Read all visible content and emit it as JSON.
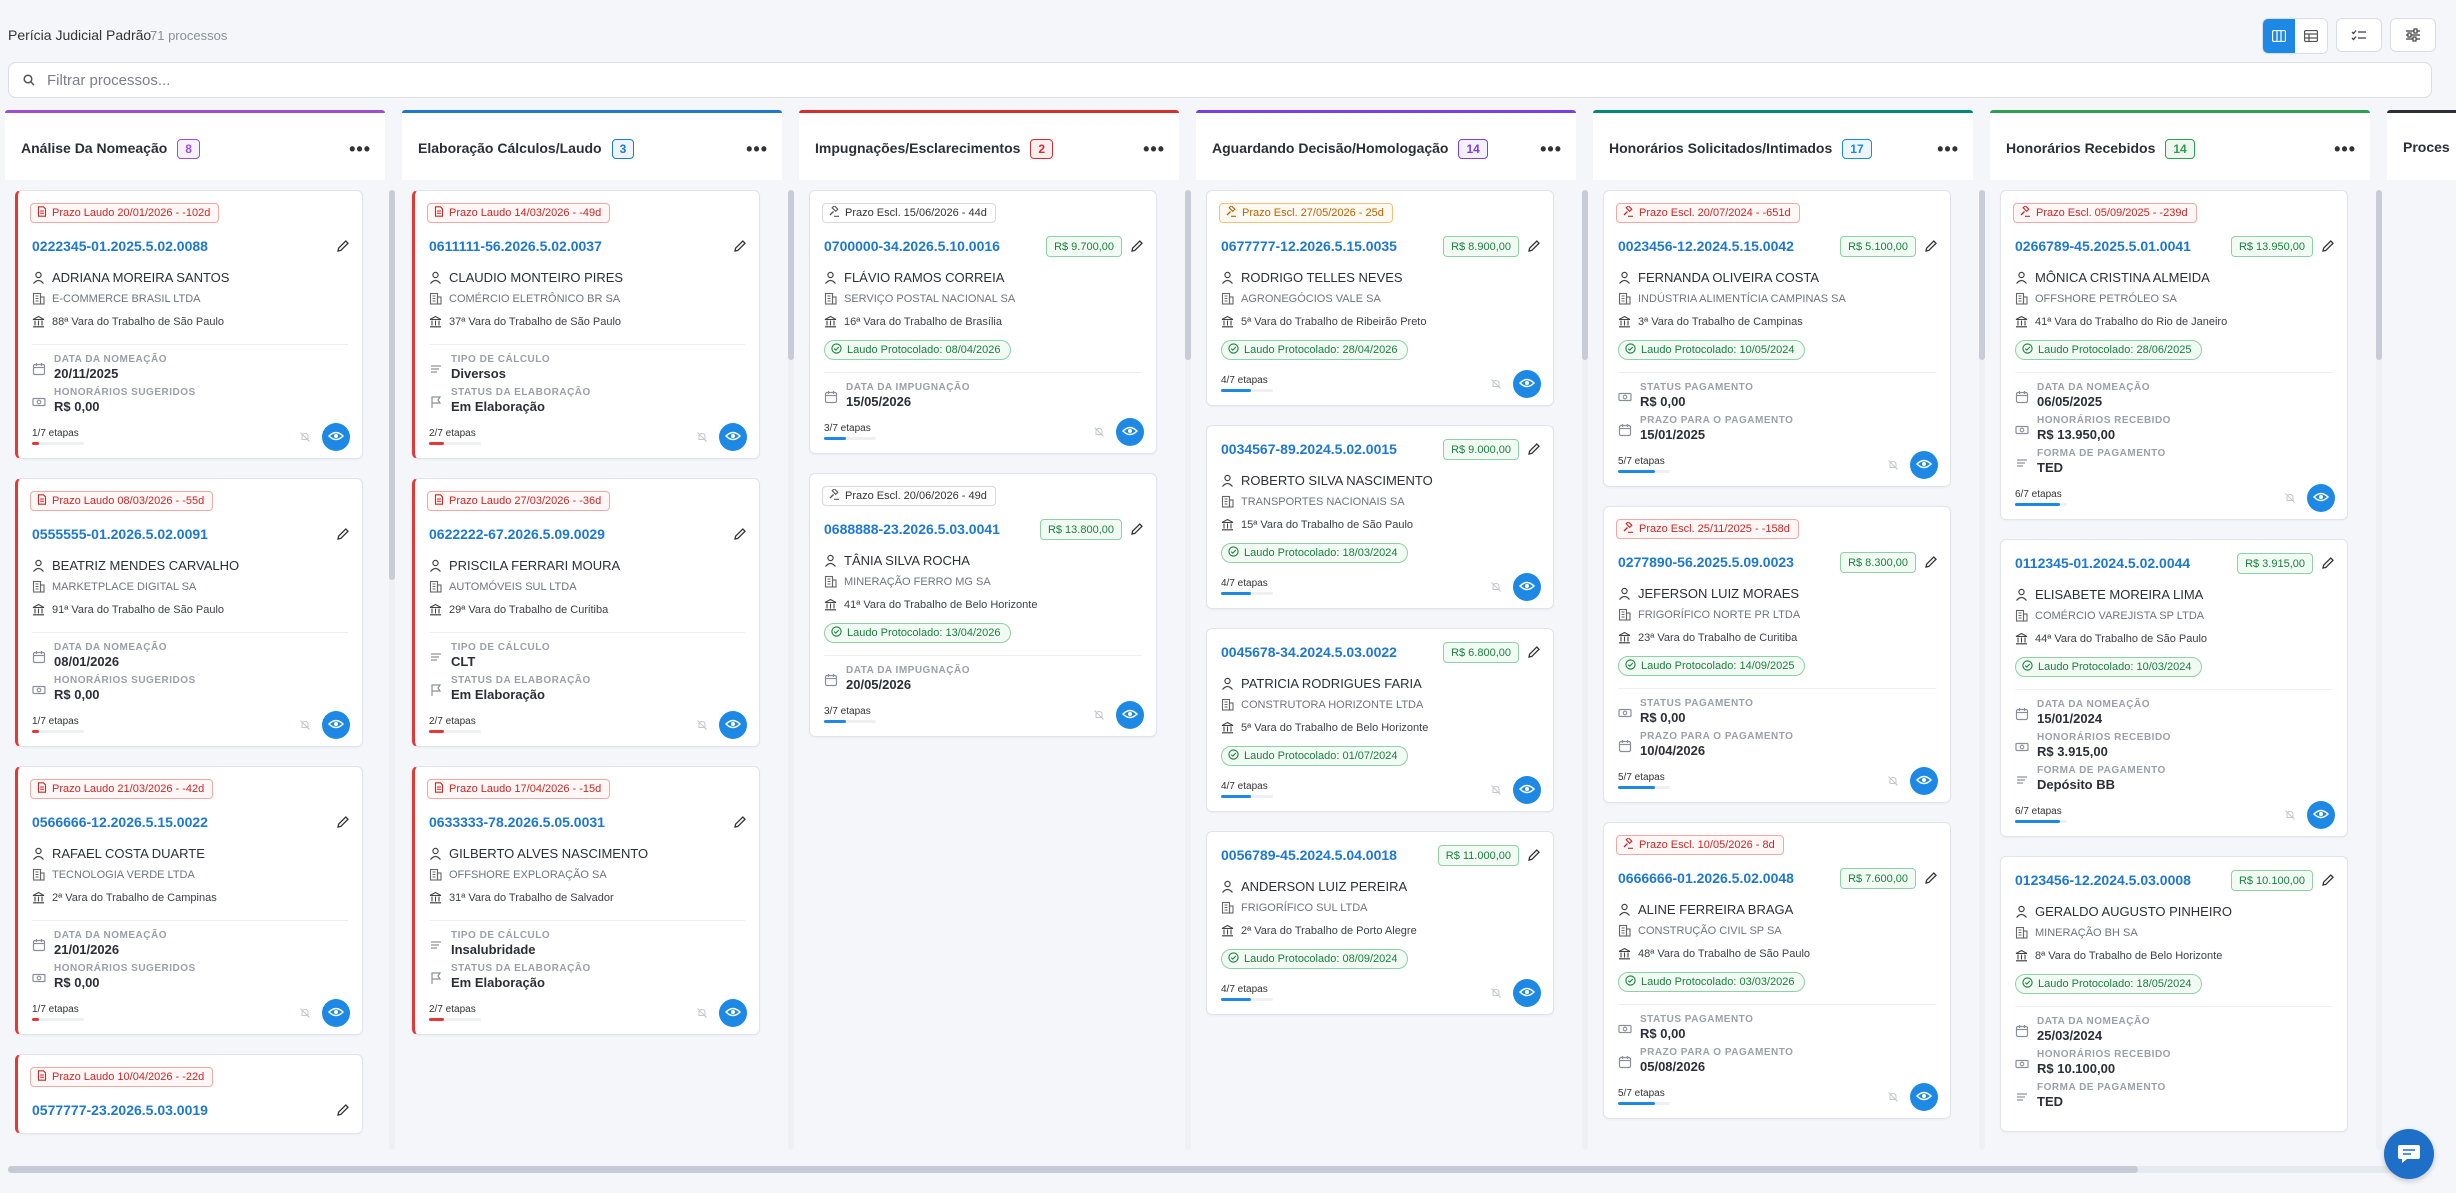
{
  "header": {
    "title": "Perícia Judicial Padrão",
    "count": "71 processos"
  },
  "search": {
    "placeholder": "Filtrar processos..."
  },
  "columns": [
    {
      "name": "Análise Da Nomeação",
      "count": "8",
      "color": "#9b4fd6",
      "badge_color": "#9b4fd6",
      "cards": [
        {
          "prazo": "Prazo Laudo  20/01/2026 - -102d",
          "prazo_style": "red",
          "number": "0222345-01.2025.5.02.0088",
          "client": "ADRIANA MOREIRA SANTOS",
          "company": "E-COMMERCE BRASIL LTDA",
          "court": "88ª Vara do Trabalho de São Paulo",
          "fields": [
            {
              "label": "DATA DA NOMEAÇÃO",
              "value": "20/11/2025",
              "icon": "calendar-icon"
            },
            {
              "label": "HONORÁRIOS SUGERIDOS",
              "value": "R$ 0,00",
              "icon": "money-icon"
            }
          ],
          "etapas": "1/7 etapas",
          "progress": 0.14,
          "bar_color": "#e53935"
        },
        {
          "prazo": "Prazo Laudo  08/03/2026 - -55d",
          "prazo_style": "red",
          "number": "0555555-01.2026.5.02.0091",
          "client": "BEATRIZ MENDES CARVALHO",
          "company": "MARKETPLACE DIGITAL SA",
          "court": "91ª Vara do Trabalho de São Paulo",
          "fields": [
            {
              "label": "DATA DA NOMEAÇÃO",
              "value": "08/01/2026",
              "icon": "calendar-icon"
            },
            {
              "label": "HONORÁRIOS SUGERIDOS",
              "value": "R$ 0,00",
              "icon": "money-icon"
            }
          ],
          "etapas": "1/7 etapas",
          "progress": 0.14,
          "bar_color": "#e53935"
        },
        {
          "prazo": "Prazo Laudo  21/03/2026 - -42d",
          "prazo_style": "red",
          "number": "0566666-12.2026.5.15.0022",
          "client": "RAFAEL COSTA DUARTE",
          "company": "TECNOLOGIA VERDE LTDA",
          "court": "2ª Vara do Trabalho de Campinas",
          "fields": [
            {
              "label": "DATA DA NOMEAÇÃO",
              "value": "21/01/2026",
              "icon": "calendar-icon"
            },
            {
              "label": "HONORÁRIOS SUGERIDOS",
              "value": "R$ 0,00",
              "icon": "money-icon"
            }
          ],
          "etapas": "1/7 etapas",
          "progress": 0.14,
          "bar_color": "#e53935"
        },
        {
          "prazo": "Prazo Laudo  10/04/2026 - -22d",
          "prazo_style": "red",
          "number": "0577777-23.2026.5.03.0019"
        }
      ]
    },
    {
      "name": "Elaboração Cálculos/Laudo",
      "count": "3",
      "color": "#1e78d2",
      "badge_color": "#1e78d2",
      "cards": [
        {
          "prazo": "Prazo Laudo  14/03/2026 - -49d",
          "prazo_style": "red",
          "number": "0611111-56.2026.5.02.0037",
          "client": "CLAUDIO MONTEIRO PIRES",
          "company": "COMÉRCIO ELETRÔNICO BR SA",
          "court": "37ª Vara do Trabalho de São Paulo",
          "fields": [
            {
              "label": "TIPO DE CÁLCULO",
              "value": "Diversos",
              "icon": "list-icon"
            },
            {
              "label": "STATUS DA ELABORAÇÃO",
              "value": "Em Elaboração",
              "icon": "flag-icon"
            }
          ],
          "etapas": "2/7 etapas",
          "progress": 0.28,
          "bar_color": "#e53935"
        },
        {
          "prazo": "Prazo Laudo  27/03/2026 - -36d",
          "prazo_style": "red",
          "number": "0622222-67.2026.5.09.0029",
          "client": "PRISCILA FERRARI MOURA",
          "company": "AUTOMÓVEIS SUL LTDA",
          "court": "29ª Vara do Trabalho de Curitiba",
          "fields": [
            {
              "label": "TIPO DE CÁLCULO",
              "value": "CLT",
              "icon": "list-icon"
            },
            {
              "label": "STATUS DA ELABORAÇÃO",
              "value": "Em Elaboração",
              "icon": "flag-icon"
            }
          ],
          "etapas": "2/7 etapas",
          "progress": 0.28,
          "bar_color": "#e53935"
        },
        {
          "prazo": "Prazo Laudo  17/04/2026 - -15d",
          "prazo_style": "red",
          "number": "0633333-78.2026.5.05.0031",
          "client": "GILBERTO ALVES NASCIMENTO",
          "company": "OFFSHORE EXPLORAÇÃO SA",
          "court": "31ª Vara do Trabalho de Salvador",
          "fields": [
            {
              "label": "TIPO DE CÁLCULO",
              "value": "Insalubridade",
              "icon": "list-icon"
            },
            {
              "label": "STATUS DA ELABORAÇÃO",
              "value": "Em Elaboração",
              "icon": "flag-icon"
            }
          ],
          "etapas": "2/7 etapas",
          "progress": 0.28,
          "bar_color": "#e53935"
        }
      ]
    },
    {
      "name": "Impugnações/Esclarecimentos",
      "count": "2",
      "color": "#d32f2f",
      "badge_color": "#d32f2f",
      "cards": [
        {
          "prazo": "Prazo Escl.  15/06/2026 - 44d",
          "prazo_style": "gray",
          "number": "0700000-34.2026.5.10.0016",
          "money": "R$ 9.700,00",
          "client": "FLÁVIO RAMOS CORREIA",
          "company": "SERVIÇO POSTAL NACIONAL SA",
          "court": "16ª Vara do Trabalho de Brasília",
          "laudo": "Laudo Protocolado: 08/04/2026",
          "fields": [
            {
              "label": "DATA DA IMPUGNAÇÃO",
              "value": "15/05/2026",
              "icon": "calendar-icon"
            }
          ],
          "etapas": "3/7 etapas",
          "progress": 0.43,
          "bar_color": "#1e88e5"
        },
        {
          "prazo": "Prazo Escl.  20/06/2026 - 49d",
          "prazo_style": "gray",
          "number": "0688888-23.2026.5.03.0041",
          "money": "R$ 13.800,00",
          "client": "TÂNIA SILVA ROCHA",
          "company": "MINERAÇÃO FERRO MG SA",
          "court": "41ª Vara do Trabalho de Belo Horizonte",
          "laudo": "Laudo Protocolado: 13/04/2026",
          "fields": [
            {
              "label": "DATA DA IMPUGNAÇÃO",
              "value": "20/05/2026",
              "icon": "calendar-icon"
            }
          ],
          "etapas": "3/7 etapas",
          "progress": 0.43,
          "bar_color": "#1e88e5"
        }
      ]
    },
    {
      "name": "Aguardando Decisão/Homologação",
      "count": "14",
      "color": "#7b3fe4",
      "badge_color": "#7b3fe4",
      "cards": [
        {
          "prazo": "Prazo Escl.  27/05/2026 - 25d",
          "prazo_style": "orange",
          "number": "0677777-12.2026.5.15.0035",
          "money": "R$ 8.900,00",
          "client": "RODRIGO TELLES NEVES",
          "company": "AGRONEGÓCIOS VALE SA",
          "court": "5ª Vara do Trabalho de Ribeirão Preto",
          "laudo": "Laudo Protocolado: 28/04/2026",
          "fields": [],
          "etapas": "4/7 etapas",
          "progress": 0.57,
          "bar_color": "#1e88e5"
        },
        {
          "number": "0034567-89.2024.5.02.0015",
          "money": "R$ 9.000,00",
          "client": "ROBERTO SILVA NASCIMENTO",
          "company": "TRANSPORTES NACIONAIS SA",
          "court": "15ª Vara do Trabalho de São Paulo",
          "laudo": "Laudo Protocolado: 18/03/2024",
          "fields": [],
          "etapas": "4/7 etapas",
          "progress": 0.57,
          "bar_color": "#1e88e5"
        },
        {
          "number": "0045678-34.2024.5.03.0022",
          "money": "R$ 6.800,00",
          "client": "PATRICIA RODRIGUES FARIA",
          "company": "CONSTRUTORA HORIZONTE LTDA",
          "court": "5ª Vara do Trabalho de Belo Horizonte",
          "laudo": "Laudo Protocolado: 01/07/2024",
          "fields": [],
          "etapas": "4/7 etapas",
          "progress": 0.57,
          "bar_color": "#1e88e5"
        },
        {
          "number": "0056789-45.2024.5.04.0018",
          "money": "R$ 11.000,00",
          "client": "ANDERSON LUIZ PEREIRA",
          "company": "FRIGORÍFICO SUL LTDA",
          "court": "2ª Vara do Trabalho de Porto Alegre",
          "laudo": "Laudo Protocolado: 08/09/2024",
          "fields": [],
          "etapas": "4/7 etapas",
          "progress": 0.57,
          "bar_color": "#1e88e5"
        }
      ]
    },
    {
      "name": "Honorários Solicitados/Intimados",
      "count": "17",
      "color": "#00897b",
      "badge_color": "#1e88e5",
      "cards": [
        {
          "prazo": "Prazo Escl.  20/07/2024 - -651d",
          "prazo_style": "red",
          "number": "0023456-12.2024.5.15.0042",
          "money": "R$ 5.100,00",
          "client": "FERNANDA OLIVEIRA COSTA",
          "company": "INDÚSTRIA ALIMENTÍCIA CAMPINAS SA",
          "court": "3ª Vara do Trabalho de Campinas",
          "laudo": "Laudo Protocolado: 10/05/2024",
          "fields": [
            {
              "label": "STATUS PAGAMENTO",
              "value": "R$ 0,00",
              "icon": "money-icon"
            },
            {
              "label": "PRAZO PARA O PAGAMENTO",
              "value": "15/01/2025",
              "icon": "calendar-icon"
            }
          ],
          "etapas": "5/7 etapas",
          "progress": 0.71,
          "bar_color": "#1e88e5"
        },
        {
          "prazo": "Prazo Escl.  25/11/2025 - -158d",
          "prazo_style": "red",
          "number": "0277890-56.2025.5.09.0023",
          "money": "R$ 8.300,00",
          "client": "JEFERSON LUIZ MORAES",
          "company": "FRIGORÍFICO NORTE PR LTDA",
          "court": "23ª Vara do Trabalho de Curitiba",
          "laudo": "Laudo Protocolado: 14/09/2025",
          "fields": [
            {
              "label": "STATUS PAGAMENTO",
              "value": "R$ 0,00",
              "icon": "money-icon"
            },
            {
              "label": "PRAZO PARA O PAGAMENTO",
              "value": "10/04/2026",
              "icon": "calendar-icon"
            }
          ],
          "etapas": "5/7 etapas",
          "progress": 0.71,
          "bar_color": "#1e88e5"
        },
        {
          "prazo": "Prazo Escl.  10/05/2026 - 8d",
          "prazo_style": "red",
          "number": "0666666-01.2026.5.02.0048",
          "money": "R$ 7.600,00",
          "client": "ALINE FERREIRA BRAGA",
          "company": "CONSTRUÇÃO CIVIL SP SA",
          "court": "48ª Vara do Trabalho de São Paulo",
          "laudo": "Laudo Protocolado: 03/03/2026",
          "fields": [
            {
              "label": "STATUS PAGAMENTO",
              "value": "R$ 0,00",
              "icon": "money-icon"
            },
            {
              "label": "PRAZO PARA O PAGAMENTO",
              "value": "05/08/2026",
              "icon": "calendar-icon"
            }
          ],
          "etapas": "5/7 etapas",
          "progress": 0.71,
          "bar_color": "#1e88e5"
        }
      ]
    },
    {
      "name": "Honorários Recebidos",
      "count": "14",
      "color": "#2e9e4f",
      "badge_color": "#2e9e4f",
      "cards": [
        {
          "prazo": "Prazo Escl.  05/09/2025 - -239d",
          "prazo_style": "red",
          "number": "0266789-45.2025.5.01.0041",
          "money": "R$ 13.950,00",
          "client": "MÔNICA CRISTINA ALMEIDA",
          "company": "OFFSHORE PETRÓLEO SA",
          "court": "41ª Vara do Trabalho do Rio de Janeiro",
          "laudo": "Laudo Protocolado: 28/06/2025",
          "fields": [
            {
              "label": "DATA DA NOMEAÇÃO",
              "value": "06/05/2025",
              "icon": "calendar-icon"
            },
            {
              "label": "HONORÁRIOS RECEBIDO",
              "value": "R$ 13.950,00",
              "icon": "money-icon"
            },
            {
              "label": "FORMA DE PAGAMENTO",
              "value": "TED",
              "icon": "list-icon"
            }
          ],
          "etapas": "6/7 etapas",
          "progress": 0.86,
          "bar_color": "#1e88e5"
        },
        {
          "number": "0112345-01.2024.5.02.0044",
          "money": "R$ 3.915,00",
          "client": "ELISABETE MOREIRA LIMA",
          "company": "COMÉRCIO VAREJISTA SP LTDA",
          "court": "44ª Vara do Trabalho de São Paulo",
          "laudo": "Laudo Protocolado: 10/03/2024",
          "fields": [
            {
              "label": "DATA DA NOMEAÇÃO",
              "value": "15/01/2024",
              "icon": "calendar-icon"
            },
            {
              "label": "HONORÁRIOS RECEBIDO",
              "value": "R$ 3.915,00",
              "icon": "money-icon"
            },
            {
              "label": "FORMA DE PAGAMENTO",
              "value": "Depósito BB",
              "icon": "list-icon"
            }
          ],
          "etapas": "6/7 etapas",
          "progress": 0.86,
          "bar_color": "#1e88e5"
        },
        {
          "number": "0123456-12.2024.5.03.0008",
          "money": "R$ 10.100,00",
          "client": "GERALDO AUGUSTO PINHEIRO",
          "company": "MINERAÇÃO BH SA",
          "court": "8ª Vara do Trabalho de Belo Horizonte",
          "laudo": "Laudo Protocolado: 18/05/2024",
          "fields": [
            {
              "label": "DATA DA NOMEAÇÃO",
              "value": "25/03/2024",
              "icon": "calendar-icon"
            },
            {
              "label": "HONORÁRIOS RECEBIDO",
              "value": "R$ 10.100,00",
              "icon": "money-icon"
            },
            {
              "label": "FORMA DE PAGAMENTO",
              "value": "TED",
              "icon": "list-icon"
            }
          ]
        }
      ]
    },
    {
      "name": "Proces",
      "count": "",
      "color": "#2b2f38",
      "badge_color": "#2b2f38",
      "cards": []
    }
  ],
  "colors": {
    "accent": "#1e88e5",
    "overdue": "#e53935",
    "success": "#1b7f3f"
  },
  "icons": [
    "search-icon",
    "kanban-view-icon",
    "table-view-icon",
    "checklist-icon",
    "settings-sliders-icon",
    "chat-icon",
    "pencil-icon",
    "eye-icon",
    "bell-off-icon"
  ]
}
